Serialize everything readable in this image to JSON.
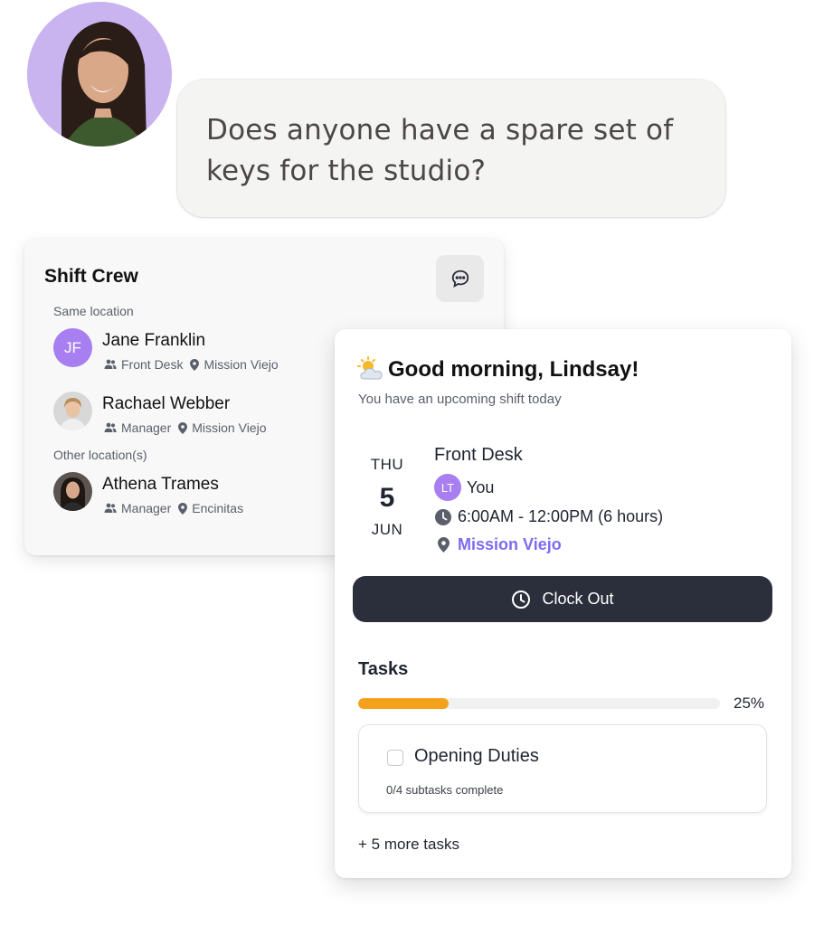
{
  "bubble": {
    "line1": "Does anyone have a spare set of",
    "line2": "keys for the studio?"
  },
  "crew": {
    "title": "Shift Crew",
    "chat_icon": "chat-bubble-icon",
    "same_location_label": "Same location",
    "other_location_label": "Other location(s)",
    "people": [
      {
        "initials": "JF",
        "name": "Jane Franklin",
        "role": "Front Desk",
        "location": "Mission Viejo"
      },
      {
        "initials": "",
        "name": "Rachael Webber",
        "role": "Manager",
        "location": "Mission Viejo"
      },
      {
        "initials": "",
        "name": "Athena Trames",
        "role": "Manager",
        "location": "Encinitas"
      }
    ]
  },
  "shift": {
    "greeting": "Good morning, Lindsay!",
    "subgreeting": "You have an upcoming shift today",
    "date": {
      "dow": "THU",
      "day": "5",
      "month": "JUN"
    },
    "role": "Front Desk",
    "assignee_initials": "LT",
    "assignee_label": "You",
    "time": "6:00AM - 12:00PM (6 hours)",
    "location": "Mission Viejo",
    "clock_button": "Clock Out"
  },
  "tasks": {
    "title": "Tasks",
    "progress_percent": 25,
    "progress_label": "25%",
    "items": [
      {
        "name": "Opening Duties",
        "subtasks": "0/4 subtasks complete",
        "done": false
      }
    ],
    "more_label": "+ 5 more tasks"
  },
  "colors": {
    "accent_purple": "#a77ff0",
    "link_purple": "#7b6cf0",
    "progress_orange": "#f4a21c",
    "button_dark": "#2a2f3b"
  }
}
